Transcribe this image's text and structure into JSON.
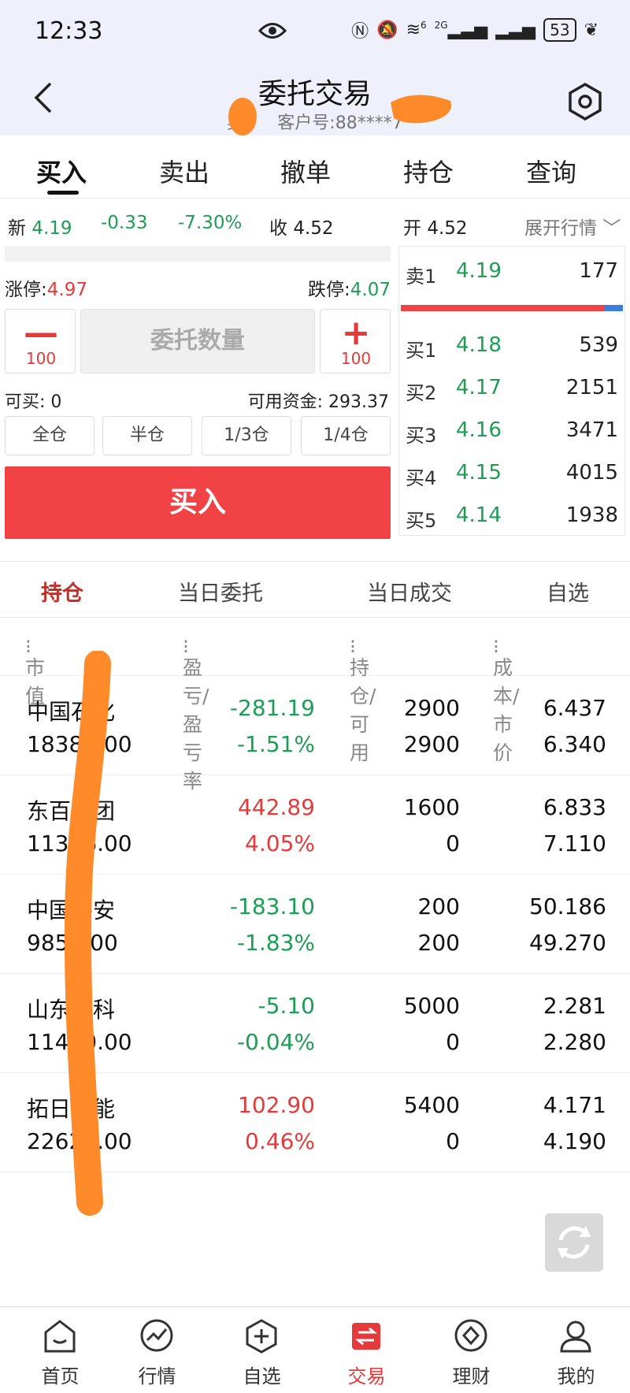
{
  "status_bar": {
    "time": "12:33",
    "network": "6",
    "net2": "2G",
    "battery": "53"
  },
  "header": {
    "title": "委托交易",
    "name_char": "吴",
    "account_label": "客户号:88****7"
  },
  "tabs": [
    {
      "label": "买入",
      "active": true
    },
    {
      "label": "卖出"
    },
    {
      "label": "撤单"
    },
    {
      "label": "持仓"
    },
    {
      "label": "查询"
    }
  ],
  "quote": {
    "new_label": "新",
    "new_value": "4.19",
    "change": "-0.33",
    "change_pct": "-7.30%",
    "close_label": "收",
    "close_value": "4.52",
    "open_label": "开",
    "open_value": "4.52",
    "expand": "展开行情"
  },
  "form": {
    "limit_up_label": "涨停:",
    "limit_up_value": "4.97",
    "limit_down_label": "跌停:",
    "limit_down_value": "4.07",
    "minus_label": "100",
    "plus_label": "100",
    "qty_placeholder": "委托数量",
    "can_buy_label": "可买:",
    "can_buy_value": "0",
    "fund_label": "可用资金:",
    "fund_value": "293.37",
    "portions": [
      "全仓",
      "半仓",
      "1/3仓",
      "1/4仓"
    ],
    "buy_button": "买入"
  },
  "order_book": {
    "sell": [
      {
        "label": "卖1",
        "price": "4.19",
        "volume": "177"
      }
    ],
    "buy_sell_ratio": 0.92,
    "buy": [
      {
        "label": "买1",
        "price": "4.18",
        "volume": "539"
      },
      {
        "label": "买2",
        "price": "4.17",
        "volume": "2151"
      },
      {
        "label": "买3",
        "price": "4.16",
        "volume": "3471"
      },
      {
        "label": "买4",
        "price": "4.15",
        "volume": "4015"
      },
      {
        "label": "买5",
        "price": "4.14",
        "volume": "1938"
      }
    ]
  },
  "holding_tabs": [
    {
      "label": "持仓",
      "active": true
    },
    {
      "label": "当日委托"
    },
    {
      "label": "当日成交"
    },
    {
      "label": "自选"
    }
  ],
  "columns": [
    "市值",
    "盈亏/盈亏率",
    "持仓/可用",
    "成本/市价"
  ],
  "holdings": [
    {
      "name": "中国石化",
      "market_value": "18386.00",
      "pl": "-281.19",
      "pl_pct": "-1.51%",
      "position": "2900",
      "available": "2900",
      "cost": "6.437",
      "price": "6.340",
      "sign": "neg"
    },
    {
      "name": "东百集团",
      "market_value": "11376.00",
      "pl": "442.89",
      "pl_pct": "4.05%",
      "position": "1600",
      "available": "0",
      "cost": "6.833",
      "price": "7.110",
      "sign": "pos"
    },
    {
      "name": "中国平安",
      "market_value": "9854.00",
      "pl": "-183.10",
      "pl_pct": "-1.83%",
      "position": "200",
      "available": "200",
      "cost": "50.186",
      "price": "49.270",
      "sign": "neg"
    },
    {
      "name": "山东高科",
      "market_value": "11400.00",
      "pl": "-5.10",
      "pl_pct": "-0.04%",
      "position": "5000",
      "available": "0",
      "cost": "2.281",
      "price": "2.280",
      "sign": "neg"
    },
    {
      "name": "拓日新能",
      "market_value": "22626.00",
      "pl": "102.90",
      "pl_pct": "0.46%",
      "position": "5400",
      "available": "0",
      "cost": "4.171",
      "price": "4.190",
      "sign": "pos"
    }
  ],
  "bottom_nav": [
    {
      "label": "首页",
      "icon": "home-icon"
    },
    {
      "label": "行情",
      "icon": "market-icon"
    },
    {
      "label": "自选",
      "icon": "watchlist-icon"
    },
    {
      "label": "交易",
      "icon": "trade-icon",
      "active": true
    },
    {
      "label": "理财",
      "icon": "wealth-icon"
    },
    {
      "label": "我的",
      "icon": "profile-icon"
    }
  ],
  "colors": {
    "red": "#e53a3a",
    "green": "#1f9d55",
    "buy_button": "#f14345",
    "redaction": "#ff8a2a"
  }
}
